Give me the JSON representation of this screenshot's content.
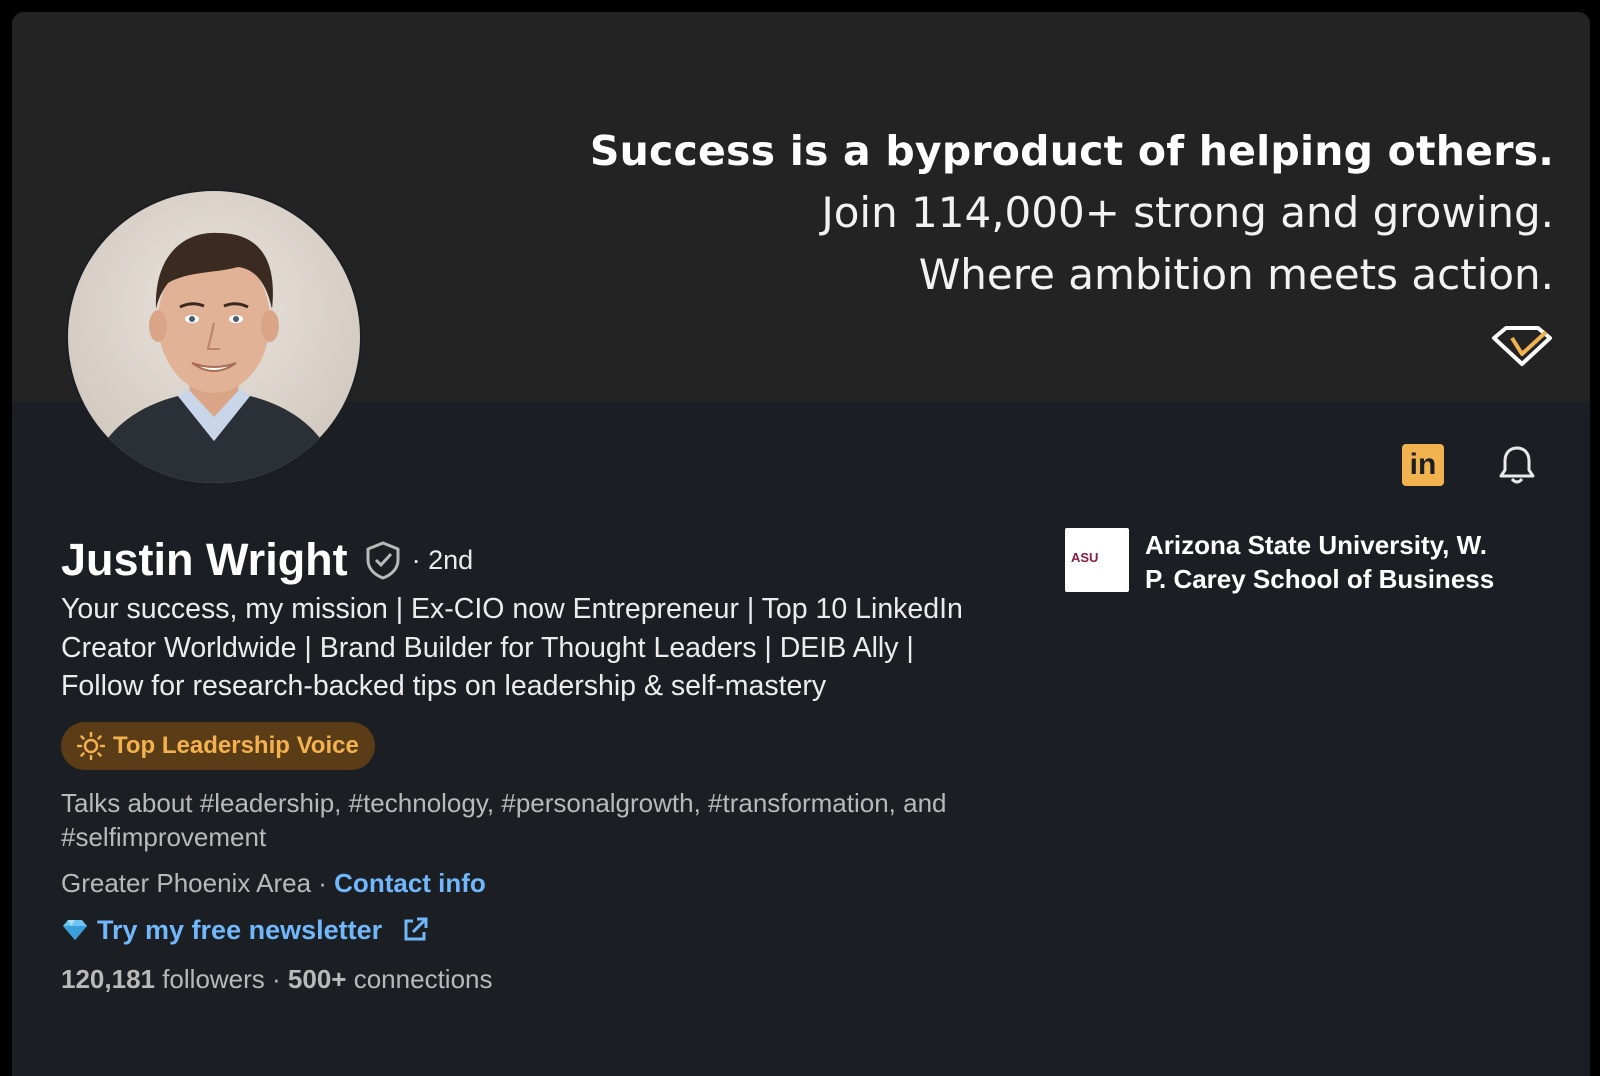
{
  "banner": {
    "line1": "Success is a byproduct of helping others.",
    "line2": "Join 114,000+ strong and growing.",
    "line3": "Where ambition meets action.",
    "logo_icon": "diamond-logo-icon"
  },
  "profile": {
    "name": "Justin Wright",
    "degree": "· 2nd",
    "headline": "Your success, my mission | Ex-CIO now Entrepreneur | Top 10 LinkedIn Creator Worldwide | Brand Builder for Thought Leaders | DEIB Ally | Follow for research-backed tips on leadership & self-mastery",
    "badge": "Top Leadership Voice",
    "talks_about": "Talks about #leadership, #technology, #personalgrowth, #transformation, and #selfimprovement",
    "location": "Greater Phoenix Area",
    "location_sep": " · ",
    "contact_label": "Contact info",
    "newsletter_label": "Try my free newsletter",
    "followers_count": "120,181",
    "followers_label": " followers",
    "connections_sep": " · ",
    "connections_count": "500+",
    "connections_label": " connections"
  },
  "school": {
    "name": "Arizona State University, W. P. Carey School of Business",
    "logo_text": "ASU"
  },
  "top_icons": {
    "linkedin": "in"
  },
  "colors": {
    "card_bg": "#1b1f23",
    "banner_bg": "#232323",
    "link": "#71b7fb",
    "badge_bg": "#5a3d17",
    "badge_text": "#f3b24e",
    "gold": "#f0b350"
  }
}
